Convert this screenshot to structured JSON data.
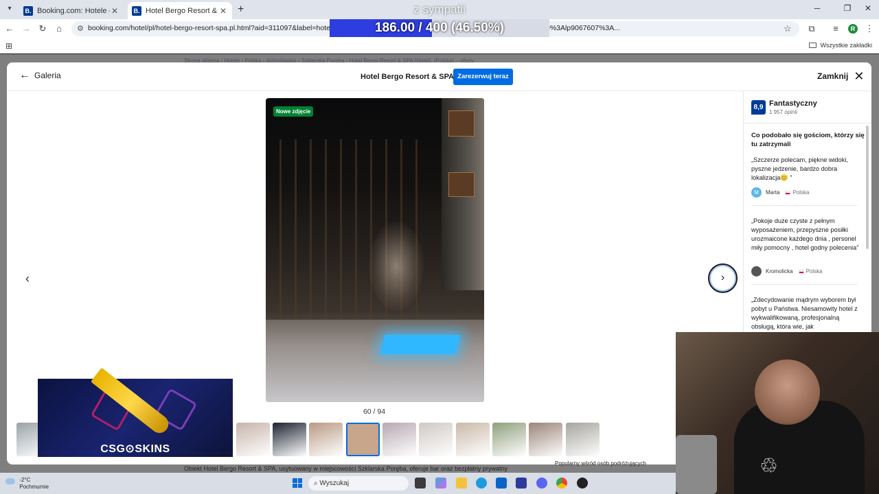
{
  "browser": {
    "tabs": [
      {
        "favicon": "B.",
        "title": "Booking.com: Hotele – Szklarsk",
        "close": "✕"
      },
      {
        "favicon": "B.",
        "title": "Hotel Bergo Resort & SPA, Szkl",
        "close": "✕"
      }
    ],
    "new_tab": "+",
    "url": "booking.com/hotel/pl/hotel-bergo-resort-spa.pl.html?aid=311097&label=hotel-bergo                                                                    3Ap2%3Aac%3Aap%3Aneg%3Afi%3Atikwd-2266886064380%3Alp9067607%3A...",
    "profile_initial": "R",
    "bookmarks_all": "Wszystkie zakładki"
  },
  "stream": {
    "title": "z sympatii",
    "progress_text": "186.00 / 400 (46.50%)",
    "progress_fraction": 0.465
  },
  "background_page": {
    "breadcrumb": "Strona główna  ›  Hotele  ›  Polska  ›  dolnośląskie  ›  Szklarska Poręba  ›  Hotel Bergo Resort & SPA (Hotel), (Polska) – oferty",
    "description": "Obiekt Hotel Bergo Resort & SPA, usytuowany w miejscowości Szklarska Poręba, oferuje bar oraz bezpłatny prywatny",
    "popular": "Popularny wśród osób podróżujących"
  },
  "modal": {
    "back_label": "Galeria",
    "hotel_name": "Hotel Bergo Resort & SPA",
    "reserve_label": "Zarezerwuj teraz",
    "close_label": "Zamknij",
    "photo_badge": "Nowe zdjęcie",
    "counter": "60 / 94",
    "thumbnail_colors": [
      "#9aa3a8",
      "#6f8a8c",
      "#b7c6d2",
      "#c9d6df",
      "#cfd9e1",
      "#d8dde0",
      "#c7b3ab",
      "#1b2230",
      "#b99a85",
      "#c7a68c",
      "#b7a8b2",
      "#cfc9c4",
      "#c9b9a8",
      "#8fa07c",
      "#9a8478",
      "#a6a49e"
    ],
    "active_thumbnail": 9
  },
  "reviews": {
    "score": "8,9",
    "score_word": "Fantastyczny",
    "count": "1 957 opinii",
    "liked_title": "Co podobało się gościom, którzy się tu zatrzymali",
    "items": [
      {
        "text": "„Szczerze polecam, piękne widoki, pyszne jedzenie, bardzo dobra lokalizacja😊 ”",
        "author_initial": "M",
        "author": "Marta",
        "country": "Polska"
      },
      {
        "text": "„Pokoje duże czyste z pełnym wyposażeniem, przepyszne posiłki urozmaicone każdego dnia , personel miły pomocny , hotel godny polecenia”",
        "author_initial": "",
        "author": "Kromolicka",
        "country": "Polska"
      },
      {
        "text": "„Zdecydowanie mądrym wyborem był pobyt u Państwa. Niesamowity hotel z wykwalifikowaną, profesjonalną obsługą, która wie, jak",
        "author_initial": "",
        "author": "",
        "country": ""
      }
    ]
  },
  "ad": {
    "logo_text": "CSG⊙SKINS"
  },
  "taskbar": {
    "temperature": "-2°C",
    "weather": "Pochmurnie",
    "search_placeholder": "Wyszukaj"
  },
  "colors": {
    "booking_blue": "#003b95",
    "button_blue": "#006ce4",
    "badge_green": "#008234",
    "progress_fill": "#2d3de0"
  }
}
